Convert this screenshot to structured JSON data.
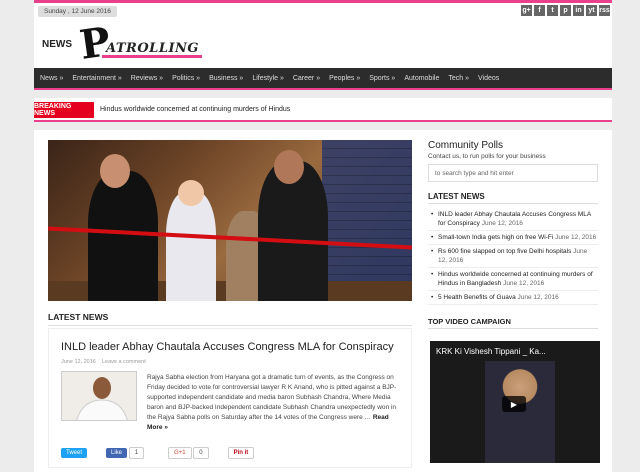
{
  "topbar": {
    "date": "Sunday , 12 June 2016"
  },
  "social": [
    "g+",
    "f",
    "t",
    "p",
    "in",
    "yt",
    "rss"
  ],
  "logo": {
    "news": "NEWS",
    "p": "P",
    "rest": "ATROLLING"
  },
  "nav": [
    "News »",
    "Entertainment »",
    "Reviews »",
    "Politics »",
    "Business »",
    "Lifestyle »",
    "Career »",
    "Peoples »",
    "Sports »",
    "Automobile",
    "Tech »",
    "Videos"
  ],
  "breaking": {
    "label": "BREAKING NEWS",
    "text": "Hindus worldwide concerned at continuing murders of Hindus"
  },
  "latest_heading": "LATEST NEWS",
  "post": {
    "title": "INLD leader Abhay Chautala Accuses Congress MLA for Conspiracy",
    "date": "June 12, 2016",
    "comment": "Leave a comment",
    "excerpt": "Rajya Sabha election from Haryana got a dramatic turn of events, as the Congress on Friday decided to vote for controversial lawyer R K Anand, who is pitted against a BJP-supported independent candidate and media baron Subhash Chandra, Where Media baron and BJP-backed Independent candidate Subhash Chandra unexpectedly won in the Rajya Sabha polls on Saturday after the 14 votes of the Congress were …",
    "read_more": "Read More »",
    "share": {
      "tweet": "Tweet",
      "like": "Like",
      "like_count": "1",
      "gplus": "G+1",
      "gplus_count": "0",
      "pin": "Pin it"
    }
  },
  "sidebar": {
    "polls_title": "Community Polls",
    "polls_sub": "Contact us, to run polls for your business",
    "search_placeholder": "to search type and hit enter",
    "latest_heading": "LATEST NEWS",
    "items": [
      {
        "title": "INLD leader Abhay Chautala Accuses Congress MLA for Conspiracy",
        "date": "June 12, 2016"
      },
      {
        "title": "Small-town India gets high on free Wi-Fi",
        "date": "June 12, 2016"
      },
      {
        "title": "Rs 600 fine slapped on top five Delhi hospitals",
        "date": "June 12, 2016"
      },
      {
        "title": "Hindus worldwide concerned at continuing murders of Hindus in Bangladesh",
        "date": "June 12, 2016"
      },
      {
        "title": "5 Health Benefits of Guava",
        "date": "June 12, 2016"
      }
    ],
    "video_heading": "TOP VIDEO CAMPAIGN",
    "video_title": "KRK Ki Vishesh Tippani _ Ka..."
  },
  "colors": {
    "accent": "#e93f8c",
    "breaking": "#e6001f",
    "nav": "#2c2c2c"
  }
}
